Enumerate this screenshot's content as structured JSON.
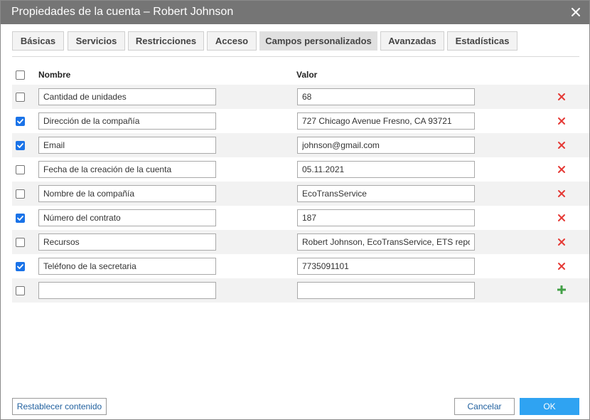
{
  "window": {
    "title": "Propiedades de la cuenta – Robert Johnson"
  },
  "tabs": [
    {
      "label": "Básicas",
      "active": false
    },
    {
      "label": "Servicios",
      "active": false
    },
    {
      "label": "Restricciones",
      "active": false
    },
    {
      "label": "Acceso",
      "active": false
    },
    {
      "label": "Campos personalizados",
      "active": true
    },
    {
      "label": "Avanzadas",
      "active": false
    },
    {
      "label": "Estadísticas",
      "active": false
    }
  ],
  "table": {
    "header_name": "Nombre",
    "header_value": "Valor",
    "select_all_checked": false,
    "rows": [
      {
        "checked": false,
        "name": "Cantidad de unidades",
        "value": "68"
      },
      {
        "checked": true,
        "name": "Dirección de la compañía",
        "value": "727 Chicago Avenue Fresno, CA 93721"
      },
      {
        "checked": true,
        "name": "Email",
        "value": "johnson@gmail.com"
      },
      {
        "checked": false,
        "name": "Fecha de la creación de la cuenta",
        "value": "05.11.2021"
      },
      {
        "checked": false,
        "name": "Nombre de la compañía",
        "value": "EcoTransService"
      },
      {
        "checked": true,
        "name": "Número del contrato",
        "value": "187"
      },
      {
        "checked": false,
        "name": "Recursos",
        "value": "Robert Johnson, EcoTransService, ETS repo"
      },
      {
        "checked": true,
        "name": "Teléfono de la secretaria",
        "value": "7735091101"
      }
    ],
    "new_row": {
      "checked": false,
      "name": "",
      "value": ""
    }
  },
  "footer": {
    "reset_label": "Restablecer contenido",
    "cancel_label": "Cancelar",
    "ok_label": "OK"
  },
  "colors": {
    "titlebar": "#757575",
    "delete_icon": "#e53935",
    "add_icon": "#43a047",
    "checkbox_checked": "#1a73e8",
    "ok_button": "#2fa3f2"
  },
  "icons": {
    "close": "close-icon",
    "delete": "delete-icon",
    "add": "plus-icon",
    "check": "checkmark-icon"
  }
}
